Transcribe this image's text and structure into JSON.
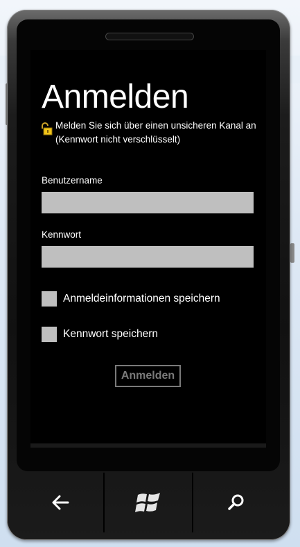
{
  "screen": {
    "title": "Anmelden",
    "warning": "Melden Sie sich über einen unsicheren Kanal an (Kennwort nicht verschlüsselt)",
    "username": {
      "label": "Benutzername",
      "value": "",
      "placeholder": ""
    },
    "password": {
      "label": "Kennwort",
      "value": "",
      "placeholder": ""
    },
    "checkboxes": [
      {
        "label": "Anmeldeinformationen speichern",
        "checked": false
      },
      {
        "label": "Kennwort speichern",
        "checked": false
      }
    ],
    "login_button": "Anmelden"
  },
  "hardware_buttons": [
    {
      "icon": "back-arrow-icon"
    },
    {
      "icon": "windows-start-icon"
    },
    {
      "icon": "search-icon"
    }
  ],
  "colors": {
    "screen_bg": "#000000",
    "input_bg": "#bfbfbf",
    "disabled_button": "#7a7a7a",
    "text": "#ffffff"
  }
}
